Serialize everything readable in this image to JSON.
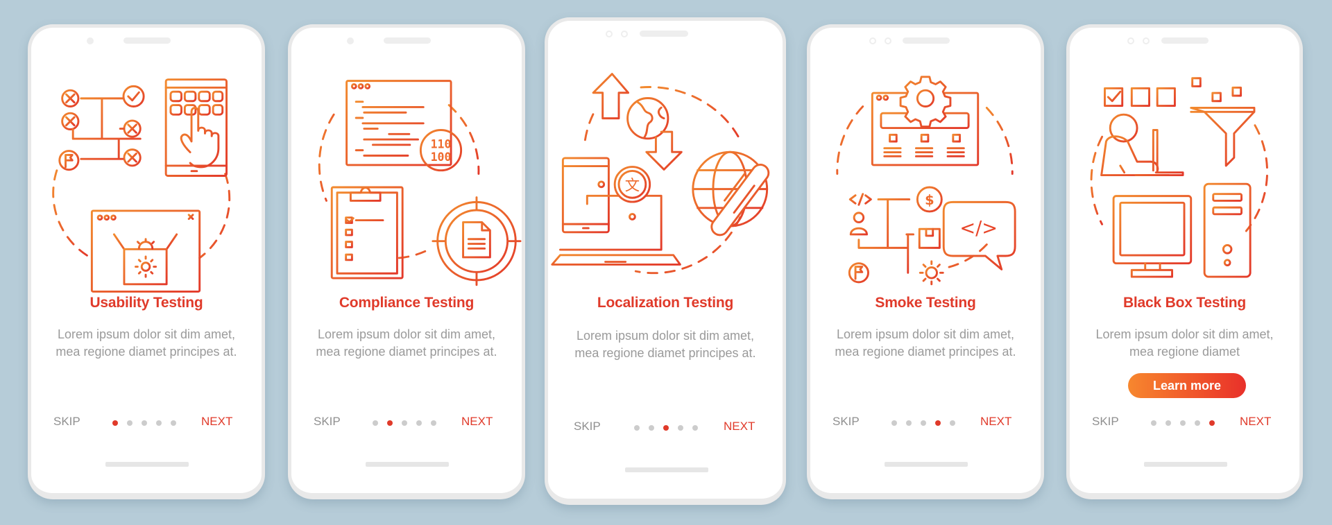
{
  "colors": {
    "background": "#b6ccd8",
    "accent": "#e03a2a",
    "gradient_start": "#f7872e",
    "gradient_end": "#e8302a",
    "body_text": "#9a9a9a",
    "dot_inactive": "#cccccc"
  },
  "screens": [
    {
      "title": "Usability Testing",
      "description": "Lorem ipsum dolor sit dim amet, mea regione diamet principes at.",
      "illustration": "usability-testing-illustration",
      "skip_label": "SKIP",
      "next_label": "NEXT",
      "page_count": 5,
      "active_page": 1
    },
    {
      "title": "Compliance Testing",
      "description": "Lorem ipsum dolor sit dim amet, mea regione diamet principes at.",
      "illustration": "compliance-testing-illustration",
      "binary_text_1": "110",
      "binary_text_2": "100",
      "skip_label": "SKIP",
      "next_label": "NEXT",
      "page_count": 5,
      "active_page": 2
    },
    {
      "title": "Localization Testing",
      "description": "Lorem ipsum dolor sit dim amet, mea regione diamet principes at.",
      "illustration": "localization-testing-illustration",
      "translate_glyph": "文",
      "skip_label": "SKIP",
      "next_label": "NEXT",
      "page_count": 5,
      "active_page": 3
    },
    {
      "title": "Smoke Testing",
      "description": "Lorem ipsum dolor sit dim amet, mea regione diamet principes at.",
      "illustration": "smoke-testing-illustration",
      "code_glyph": "</>",
      "dollar_glyph": "$",
      "skip_label": "SKIP",
      "next_label": "NEXT",
      "page_count": 5,
      "active_page": 4
    },
    {
      "title": "Black Box Testing",
      "description": "Lorem ipsum dolor sit dim amet, mea regione diamet",
      "illustration": "black-box-testing-illustration",
      "cta_label": "Learn more",
      "skip_label": "SKIP",
      "next_label": "NEXT",
      "page_count": 5,
      "active_page": 5
    }
  ]
}
